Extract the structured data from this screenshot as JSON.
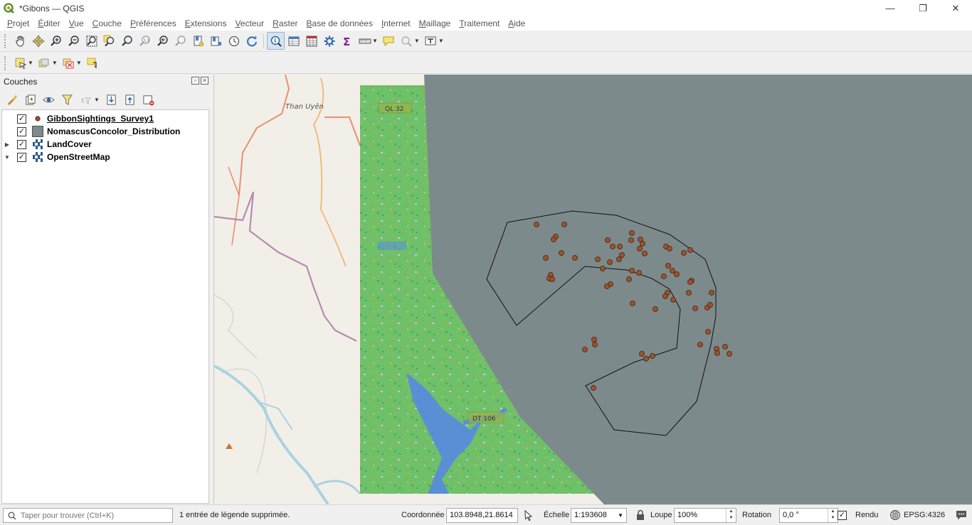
{
  "window": {
    "title": "*Gibons — QGIS",
    "controls": [
      "—",
      "❐",
      "✕"
    ]
  },
  "menu": [
    "Projet",
    "Éditer",
    "Vue",
    "Couche",
    "Préférences",
    "Extensions",
    "Vecteur",
    "Raster",
    "Base de données",
    "Internet",
    "Maillage",
    "Traitement",
    "Aide"
  ],
  "toolbar": {
    "map_navigation": [
      "pan-icon",
      "pan-to-selection-icon",
      "zoom-in-icon",
      "zoom-out-icon",
      "zoom-full-icon",
      "zoom-to-selection-icon",
      "zoom-to-layer-icon",
      "zoom-native-icon",
      "zoom-last-icon",
      "zoom-next-icon",
      "new-bookmark-icon",
      "show-bookmarks-icon",
      "temporal-controller-icon",
      "refresh-icon"
    ],
    "attributes": [
      "identify-icon",
      "open-attribute-table-icon",
      "open-field-calculator-icon",
      "processing-toolbox-icon",
      "statistics-icon",
      "measure-icon",
      "map-tips-icon",
      "annotation-icon",
      "text-annotation-icon"
    ],
    "selection": [
      "select-features-icon",
      "select-by-value-icon",
      "deselect-icon",
      "select-by-location-icon"
    ]
  },
  "layers_panel": {
    "title": "Couches",
    "toolbar": [
      "style-manager-icon",
      "add-group-icon",
      "manage-visibility-icon",
      "filter-legend-icon",
      "filter-by-expression-icon",
      "expand-all-icon",
      "collapse-all-icon",
      "remove-layer-icon"
    ],
    "layers": [
      {
        "name": "GibbonSightings_Survey1",
        "checked": true,
        "expander": "",
        "symbol": "point",
        "current": true
      },
      {
        "name": "NomascusConcolor_Distribution",
        "checked": true,
        "expander": "",
        "symbol": "polygon",
        "current": false
      },
      {
        "name": "LandCover",
        "checked": true,
        "expander": "▶",
        "symbol": "raster",
        "current": false
      },
      {
        "name": "OpenStreetMap",
        "checked": true,
        "expander": "▼",
        "symbol": "raster",
        "current": false
      }
    ]
  },
  "map": {
    "labels": {
      "town": "Than Uyên",
      "road1": "QL 32",
      "road2": "DT 106"
    },
    "colors": {
      "background": "#f2efe9",
      "distribution_fill": "#7d8a8b",
      "point_fill": "#a0522d",
      "landcover_forest": "#6cc26a",
      "water": "#5a8fd6"
    }
  },
  "statusbar": {
    "search_placeholder": "Taper pour trouver (Ctrl+K)",
    "message": "1 entrée de légende supprimée.",
    "coordinate_label": "Coordonnée",
    "coordinate_value": "103.8948,21.8614",
    "scale_label": "Échelle",
    "scale_value": "1:193608",
    "magnifier_label": "Loupe",
    "magnifier_value": "100%",
    "rotation_label": "Rotation",
    "rotation_value": "0,0 °",
    "render_label": "Rendu",
    "render_checked": true,
    "crs": "EPSG:4326"
  }
}
